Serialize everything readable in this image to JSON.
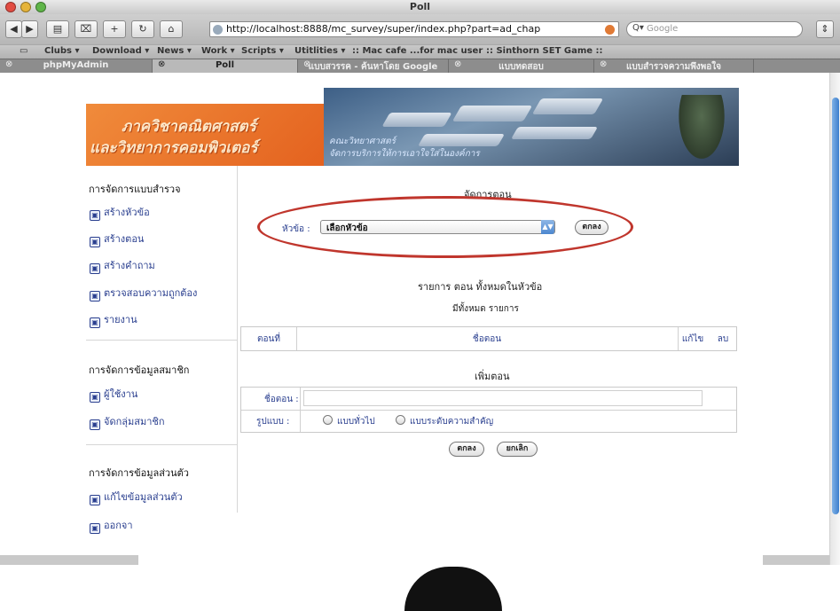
{
  "window": {
    "title": "Poll"
  },
  "toolbar": {
    "back": "◀",
    "forward": "▶",
    "url": "http://localhost:8888/mc_survey/super/index.php?part=ad_chap",
    "search_placeholder": "Google"
  },
  "bookmarks": [
    {
      "label": "Clubs ▾"
    },
    {
      "label": "Download ▾"
    },
    {
      "label": "News ▾"
    },
    {
      "label": "Work ▾"
    },
    {
      "label": "Scripts ▾"
    },
    {
      "label": "Utitlities ▾"
    },
    {
      "label": ":: Mac cafe ...for mac user"
    },
    {
      "label": ":: Sinthorn SET Game ::"
    }
  ],
  "tabs": [
    {
      "label": "phpMyAdmin"
    },
    {
      "label": "Poll"
    },
    {
      "label": "แบบสวรรค - ค้นหาโดย Google"
    },
    {
      "label": "แบบทดสอบ"
    },
    {
      "label": "แบบสำรวจความพึงพอใจ"
    }
  ],
  "banner": {
    "line1": "ภาควิชาคณิตศาสตร์",
    "line2": "และวิทยาการคอมพิวเตอร์",
    "sub1": "คณะวิทยาศาสตร์",
    "sub2": "จัดการบริการให้การเอาใจใส่ในองค์การ"
  },
  "sidebar": {
    "section1": "การจัดการแบบสำรวจ",
    "items1": [
      "สร้างหัวข้อ",
      "สร้างตอน",
      "สร้างคำถาม",
      "ตรวจสอบความถูกต้อง",
      "รายงาน"
    ],
    "section2": "การจัดการข้อมูลสมาชิก",
    "items2": [
      "ผู้ใช้งาน",
      "จัดกลุ่มสมาชิก"
    ],
    "section3": "การจัดการข้อมูลส่วนตัว",
    "items3": [
      "แก้ไขข้อมูลส่วนตัว",
      "ออกจา"
    ]
  },
  "main": {
    "title": "จัดการตอน",
    "topic_label": "หัวข้อ :",
    "topic_selected": "เลือกหัวข้อ",
    "ok_button": "ตกลง",
    "list_title": "รายการ ตอน ทั้งหมดในหัวข้อ",
    "total_text": "มีทั้งหมด รายการ",
    "table_headers": [
      "ตอนที่",
      "ชื่อตอน",
      "แก้ไข",
      "ลบ"
    ],
    "add_title": "เพิ่มตอน",
    "name_label": "ชื่อตอน :",
    "format_label": "รูปแบบ :",
    "radio_general": "แบบทั่วไป",
    "radio_priority": "แบบระดับความสำคัญ",
    "submit_button": "ตกลง",
    "cancel_button": "ยกเลิก"
  },
  "colors": {
    "highlight": "#c0362d",
    "link": "#2a3f8f",
    "banner_orange": "#e4621f"
  }
}
